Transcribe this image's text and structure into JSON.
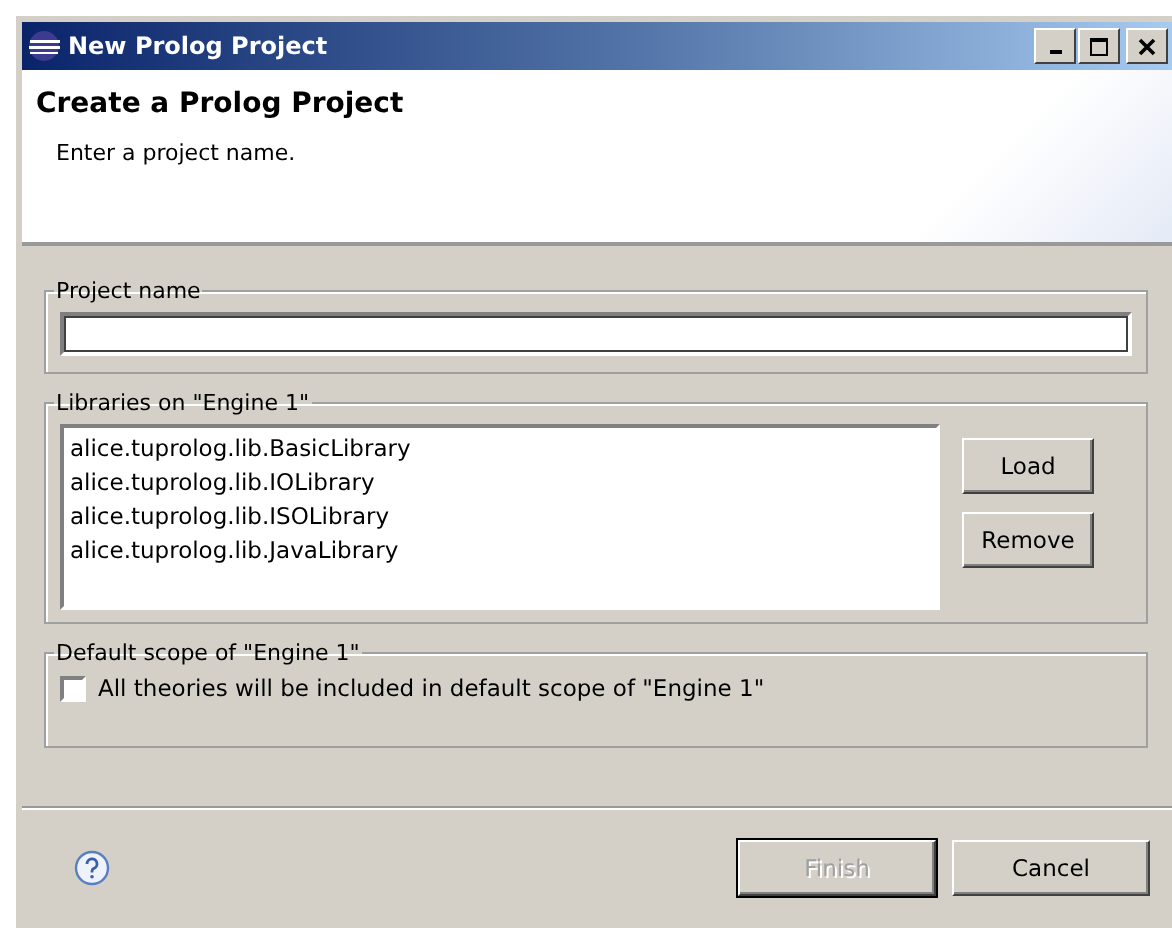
{
  "window": {
    "title": "New Prolog Project"
  },
  "header": {
    "title": "Create a Prolog Project",
    "message": "Enter a project name."
  },
  "project_name": {
    "label": "Project name"
  },
  "libraries": {
    "label": "Libraries on \"Engine 1\"",
    "items": [
      "alice.tuprolog.lib.BasicLibrary",
      "alice.tuprolog.lib.IOLibrary",
      "alice.tuprolog.lib.ISOLibrary",
      "alice.tuprolog.lib.JavaLibrary"
    ],
    "buttons": [
      "Load",
      "Remove"
    ]
  },
  "default_scope": {
    "label": "Default scope of \"Engine 1\"",
    "checkbox": {
      "label": "All theories will be included in default scope of \"Engine 1\"",
      "checked": false
    }
  },
  "buttons": [
    {
      "label": "Finish",
      "disabled": true
    },
    {
      "label": "Cancel",
      "disabled": false
    }
  ]
}
